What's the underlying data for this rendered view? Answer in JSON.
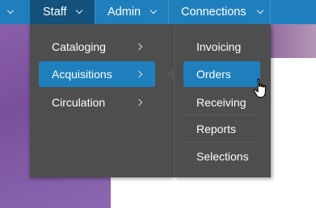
{
  "navbar": {
    "items": [
      {
        "label": "Staff"
      },
      {
        "label": "Admin"
      },
      {
        "label": "Connections"
      }
    ]
  },
  "menu_level1": {
    "items": [
      {
        "label": "Cataloging"
      },
      {
        "label": "Acquisitions",
        "selected": true
      },
      {
        "label": "Circulation"
      }
    ]
  },
  "menu_level2": {
    "items": [
      {
        "label": "Invoicing"
      },
      {
        "label": "Orders",
        "selected": true
      },
      {
        "label": "Receiving"
      },
      {
        "label": "Reports"
      },
      {
        "label": "Selections"
      }
    ]
  },
  "colors": {
    "navbar": "#1f7fbc",
    "navbar_active": "#13527d",
    "menu_bg": "#4e4e4e",
    "selected_item": "#1f7fbc"
  }
}
